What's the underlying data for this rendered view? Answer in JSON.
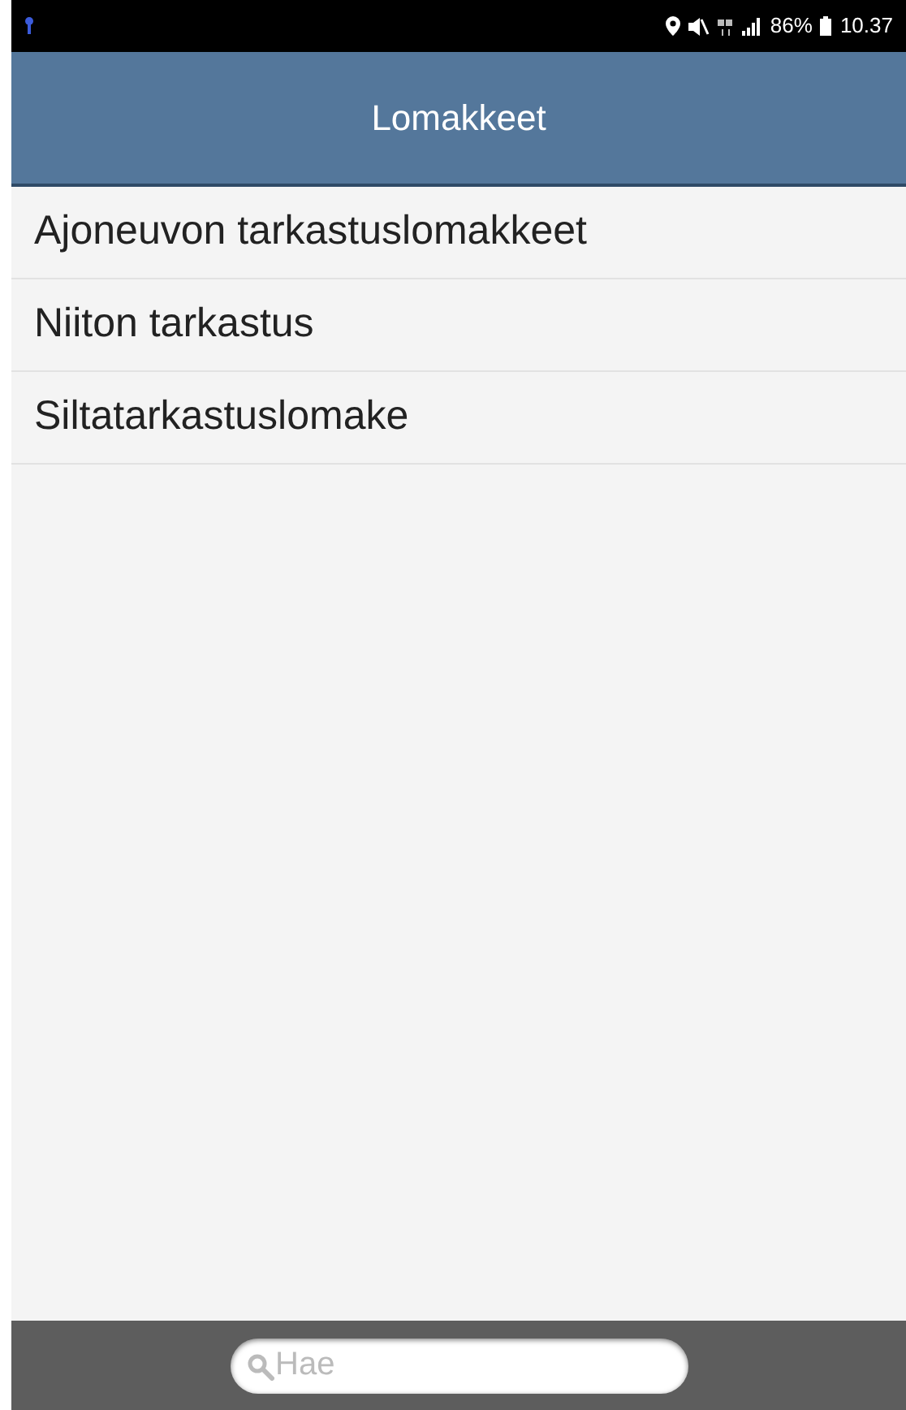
{
  "status_bar": {
    "battery": "86%",
    "time": "10.37"
  },
  "header": {
    "title": "Lomakkeet"
  },
  "forms": [
    {
      "label": "Ajoneuvon tarkastuslomakkeet"
    },
    {
      "label": "Niiton tarkastus"
    },
    {
      "label": "Siltatarkastuslomake"
    }
  ],
  "search": {
    "placeholder": "Hae"
  }
}
